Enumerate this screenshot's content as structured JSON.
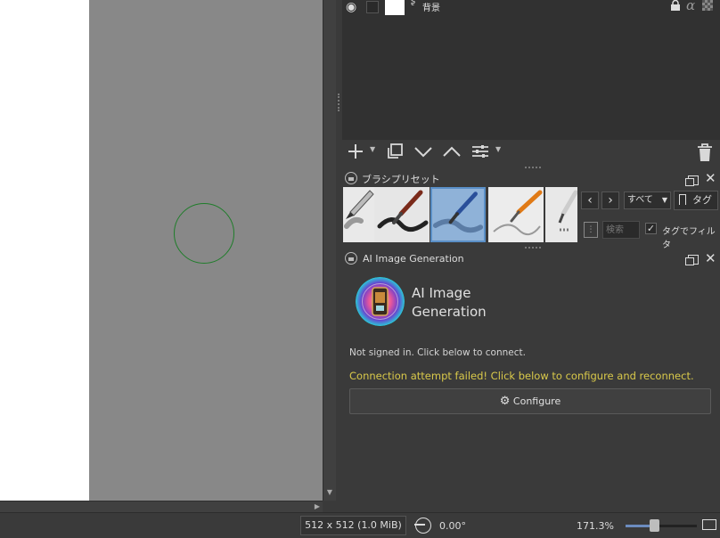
{
  "layers": {
    "layer_name": "背景",
    "alpha_symbol": "α"
  },
  "brush_presets": {
    "title": "ブラシプリセット",
    "prev_label": "‹",
    "next_label": "›",
    "tag_filter_value": "すべて",
    "tag_button_label": "タグ",
    "search_placeholder": "検索",
    "filter_by_tag_label": "タグでフィルタ",
    "filter_by_tag_checked": true,
    "selected_index": 2
  },
  "ai_panel": {
    "title": "AI Image Generation",
    "heading_line1": "AI Image",
    "heading_line2": "Generation",
    "status_text": "Not signed in. Click below to connect.",
    "error_text": "Connection attempt failed! Click below to configure and reconnect.",
    "configure_label": "Configure"
  },
  "statusbar": {
    "image_size": "512 x 512 (1.0 MiB)",
    "rotation": "0.00°",
    "zoom": "171.3%",
    "zoom_level": 0.4
  },
  "icons": {
    "eye": "eye-icon",
    "lock": "lock-icon",
    "add": "plus-icon",
    "duplicate": "duplicate-icon",
    "move_down": "chevron-down-icon",
    "move_up": "chevron-up-icon",
    "properties": "sliders-icon",
    "delete": "trash-icon",
    "float": "float-icon",
    "close": "close-icon",
    "gear": "gear-icon"
  },
  "colors": {
    "accent": "#5a8fc7",
    "error": "#d9c94a",
    "brush_cursor": "#1f7d2a"
  }
}
